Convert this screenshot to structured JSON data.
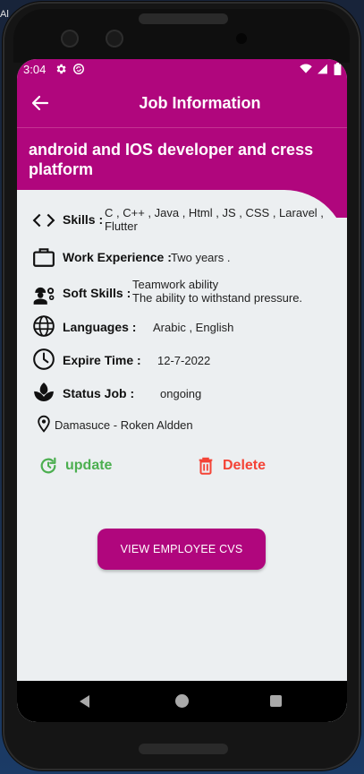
{
  "desktop": {
    "corner_text": "Al"
  },
  "status_bar": {
    "time": "3:04",
    "icons": [
      "gear-icon",
      "sync-icon",
      "wifi-icon",
      "signal-icon",
      "battery-icon"
    ]
  },
  "app_bar": {
    "title": "Job Information",
    "back_icon": "arrow-back-icon"
  },
  "job": {
    "title": "android and IOS developer and cress platform",
    "skills_label": "Skills :",
    "skills_line1": "C , C++ , Java , Html , JS , CSS , Laravel ,",
    "skills_line2": "Flutter",
    "experience_label": "Work Experience :",
    "experience_value": "Two years .",
    "soft_skills_label": "Soft Skills :",
    "soft_skills_line1": "Teamwork ability",
    "soft_skills_line2": "The ability to withstand pressure.",
    "languages_label": "Languages :",
    "languages_value": "Arabic , English",
    "expire_label": "Expire Time :",
    "expire_value": "12-7-2022",
    "status_label": "Status Job :",
    "status_value": "ongoing",
    "location_value": "Damasuce - Roken Aldden"
  },
  "actions": {
    "update_label": "update",
    "delete_label": "Delete",
    "view_cvs_label": "VIEW EMPLOYEE CVS"
  },
  "colors": {
    "primary": "#b0067d",
    "update": "#4caf50",
    "delete": "#f44336",
    "background": "#eceff1"
  }
}
